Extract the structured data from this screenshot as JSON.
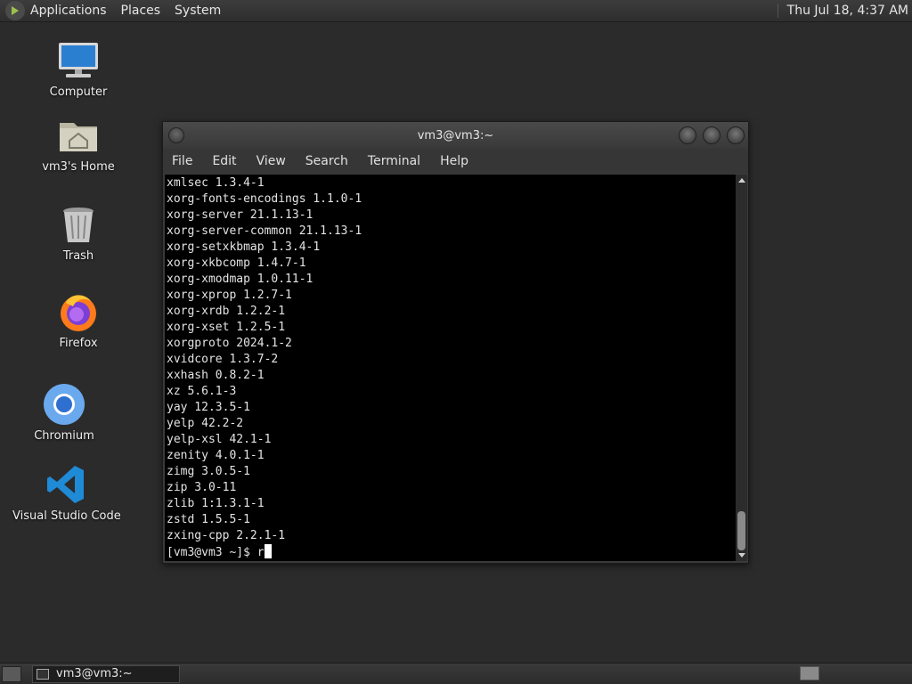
{
  "top_panel": {
    "menus": [
      "Applications",
      "Places",
      "System"
    ],
    "clock": "Thu Jul 18,  4:37 AM"
  },
  "desktop_icons": [
    {
      "label": "Computer",
      "icon": "computer-icon"
    },
    {
      "label": "vm3's Home",
      "icon": "home-folder-icon"
    },
    {
      "label": "Trash",
      "icon": "trash-icon"
    },
    {
      "label": "Firefox",
      "icon": "firefox-icon"
    },
    {
      "label": "Chromium",
      "icon": "chromium-icon"
    },
    {
      "label": "Visual Studio Code",
      "icon": "vscode-icon"
    }
  ],
  "terminal": {
    "title": "vm3@vm3:~",
    "menu": [
      "File",
      "Edit",
      "View",
      "Search",
      "Terminal",
      "Help"
    ],
    "lines": [
      "xmlsec 1.3.4-1",
      "xorg-fonts-encodings 1.1.0-1",
      "xorg-server 21.1.13-1",
      "xorg-server-common 21.1.13-1",
      "xorg-setxkbmap 1.3.4-1",
      "xorg-xkbcomp 1.4.7-1",
      "xorg-xmodmap 1.0.11-1",
      "xorg-xprop 1.2.7-1",
      "xorg-xrdb 1.2.2-1",
      "xorg-xset 1.2.5-1",
      "xorgproto 2024.1-2",
      "xvidcore 1.3.7-2",
      "xxhash 0.8.2-1",
      "xz 5.6.1-3",
      "yay 12.3.5-1",
      "yelp 42.2-2",
      "yelp-xsl 42.1-1",
      "zenity 4.0.1-1",
      "zimg 3.0.5-1",
      "zip 3.0-11",
      "zlib 1:1.3.1-1",
      "zstd 1.5.5-1",
      "zxing-cpp 2.2.1-1"
    ],
    "prompt": "[vm3@vm3 ~]$ ",
    "input": "r"
  },
  "taskbar": {
    "tasks": [
      {
        "label": "vm3@vm3:~"
      }
    ]
  }
}
